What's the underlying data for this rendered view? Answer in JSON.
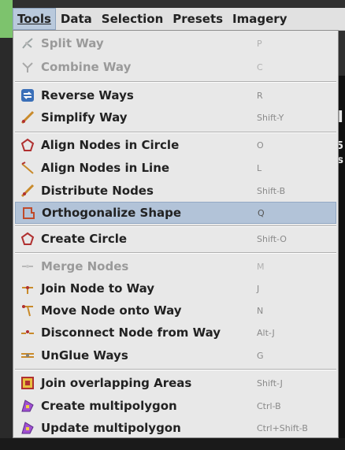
{
  "menubar": {
    "items": [
      {
        "label": "Tools",
        "mnemonic": "T"
      },
      {
        "label": "Data",
        "mnemonic": "D"
      },
      {
        "label": "Selection",
        "mnemonic": "n"
      },
      {
        "label": "Presets",
        "mnemonic": "P"
      },
      {
        "label": "Imagery",
        "mnemonic": "I"
      }
    ]
  },
  "background": {
    "frag1": "I",
    "frag2": "5",
    "frag3": "s"
  },
  "tools_menu": {
    "items": [
      {
        "label": "Split Way",
        "shortcut": "P",
        "icon": "split-way-icon",
        "enabled": false
      },
      {
        "label": "Combine Way",
        "shortcut": "C",
        "icon": "combine-way-icon",
        "enabled": false
      },
      {
        "label": "Reverse Ways",
        "shortcut": "R",
        "icon": "reverse-ways-icon",
        "enabled": true
      },
      {
        "label": "Simplify Way",
        "shortcut": "Shift-Y",
        "icon": "simplify-way-icon",
        "enabled": true
      },
      {
        "label": "Align Nodes in Circle",
        "shortcut": "O",
        "icon": "align-circle-icon",
        "enabled": true
      },
      {
        "label": "Align Nodes in Line",
        "shortcut": "L",
        "icon": "align-line-icon",
        "enabled": true
      },
      {
        "label": "Distribute Nodes",
        "shortcut": "Shift-B",
        "icon": "distribute-nodes-icon",
        "enabled": true
      },
      {
        "label": "Orthogonalize Shape",
        "shortcut": "Q",
        "icon": "orthogonalize-icon",
        "enabled": true,
        "highlighted": true
      },
      {
        "label": "Create Circle",
        "shortcut": "Shift-O",
        "icon": "create-circle-icon",
        "enabled": true
      },
      {
        "label": "Merge Nodes",
        "shortcut": "M",
        "icon": "merge-nodes-icon",
        "enabled": false
      },
      {
        "label": "Join Node to Way",
        "shortcut": "J",
        "icon": "join-node-icon",
        "enabled": true
      },
      {
        "label": "Move Node onto Way",
        "shortcut": "N",
        "icon": "move-node-icon",
        "enabled": true
      },
      {
        "label": "Disconnect Node from Way",
        "shortcut": "Alt-J",
        "icon": "disconnect-node-icon",
        "enabled": true
      },
      {
        "label": "UnGlue Ways",
        "shortcut": "G",
        "icon": "unglue-ways-icon",
        "enabled": true
      },
      {
        "label": "Join overlapping Areas",
        "shortcut": "Shift-J",
        "icon": "join-areas-icon",
        "enabled": true
      },
      {
        "label": "Create multipolygon",
        "shortcut": "Ctrl-B",
        "icon": "create-multipolygon-icon",
        "enabled": true
      },
      {
        "label": "Update multipolygon",
        "shortcut": "Ctrl+Shift-B",
        "icon": "update-multipolygon-icon",
        "enabled": true
      }
    ]
  }
}
